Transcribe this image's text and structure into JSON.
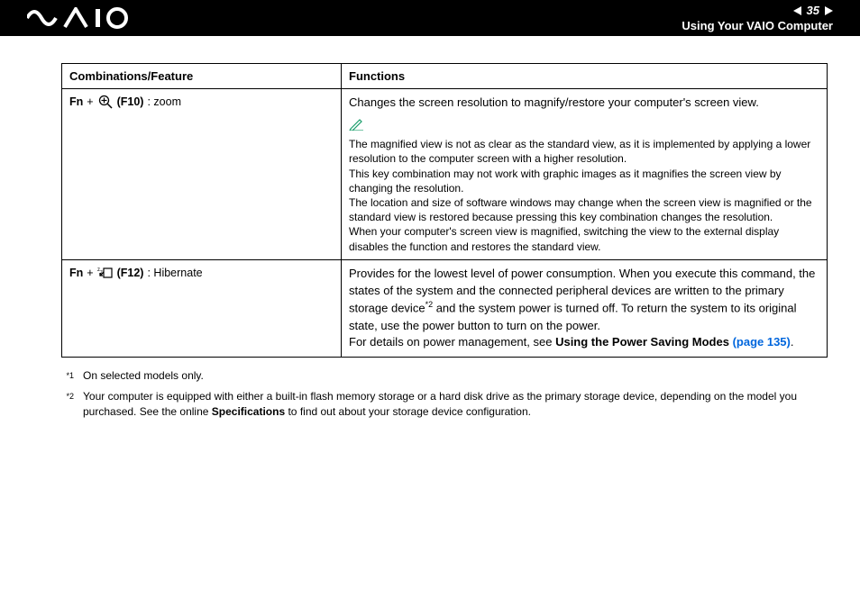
{
  "header": {
    "page_number": "35",
    "section_title": "Using Your VAIO Computer"
  },
  "table": {
    "col1_header": "Combinations/Feature",
    "col2_header": "Functions",
    "row1": {
      "fn": "Fn",
      "plus": " + ",
      "key": "(F10)",
      "label": ": zoom",
      "func_main": "Changes the screen resolution to magnify/restore your computer's screen view.",
      "note1": "The magnified view is not as clear as the standard view, as it is implemented by applying a lower resolution to the computer screen with a higher resolution.",
      "note2": "This key combination may not work with graphic images as it magnifies the screen view by changing the resolution.",
      "note3": "The location and size of software windows may change when the screen view is magnified or the standard view is restored because pressing this key combination changes the resolution.",
      "note4": "When your computer's screen view is magnified, switching the view to the external display disables the function and restores the standard view."
    },
    "row2": {
      "fn": "Fn",
      "plus": " + ",
      "key": "(F12)",
      "label": ": Hibernate",
      "func_p1a": "Provides for the lowest level of power consumption. When you execute this command, the states of the system and the connected peripheral devices are written to the primary storage device",
      "func_sup": "*2",
      "func_p1b": " and the system power is turned off. To return the system to its original state, use the power button to turn on the power.",
      "func_p2a": "For details on power management, see ",
      "func_link_bold": "Using the Power Saving Modes ",
      "func_link_page": "(page 135)",
      "func_period": "."
    }
  },
  "footnotes": {
    "f1_marker": "*1",
    "f1_text": "On selected models only.",
    "f2_marker": "*2",
    "f2_text_a": "Your computer is equipped with either a built-in flash memory storage or a hard disk drive as the primary storage device, depending on the model you purchased. See the online ",
    "f2_bold": "Specifications",
    "f2_text_b": " to find out about your storage device configuration."
  }
}
